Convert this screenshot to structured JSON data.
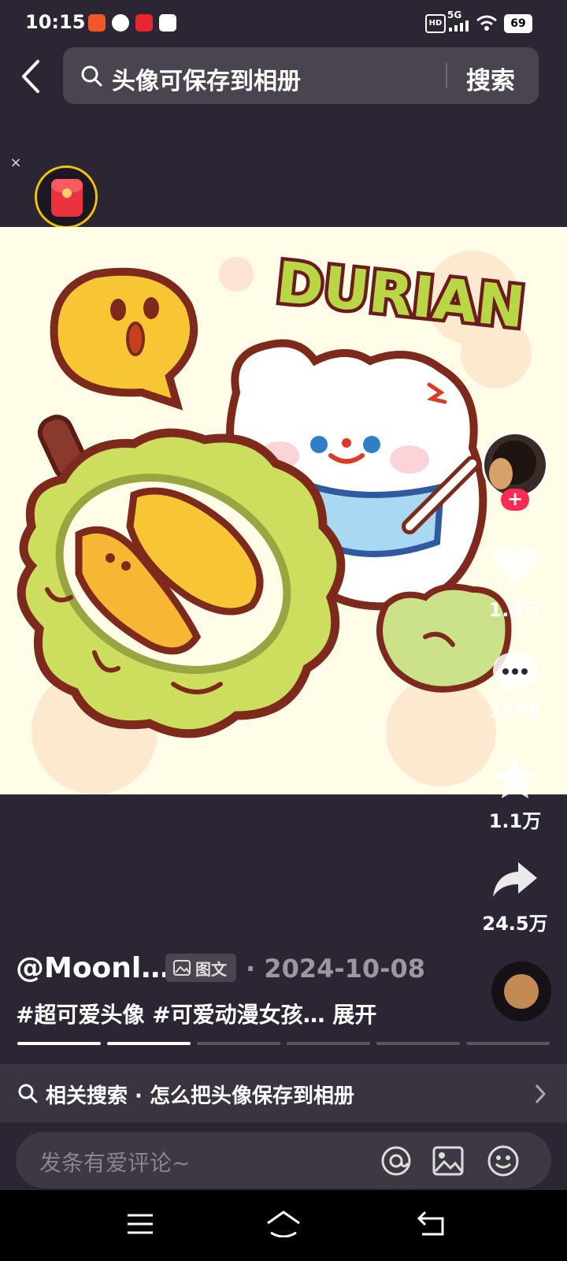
{
  "status_bar": {
    "time": "10:15",
    "network": "5G",
    "hd": "HD",
    "battery": "69"
  },
  "search": {
    "query": "头像可保存到相册",
    "button_label": "搜索"
  },
  "artwork": {
    "title_text": "DURIAN"
  },
  "actions": {
    "like_count": "1.4万",
    "comment_count": "1708",
    "favorite_count": "1.1万",
    "share_count": "24.5万"
  },
  "post": {
    "author": "@Moonl…",
    "type_tag": "图文",
    "date_sep": "·",
    "date": "2024-10-08",
    "caption": "#超可爱头像 #可爱动漫女孩… 展开"
  },
  "related_search": {
    "text": "相关搜索 · 怎么把头像保存到相册"
  },
  "comment": {
    "placeholder": "发条有爱评论~"
  },
  "colors": {
    "background": "#2c2533",
    "accent_pink": "#fe2c55",
    "artwork_bg": "#fffde8"
  }
}
